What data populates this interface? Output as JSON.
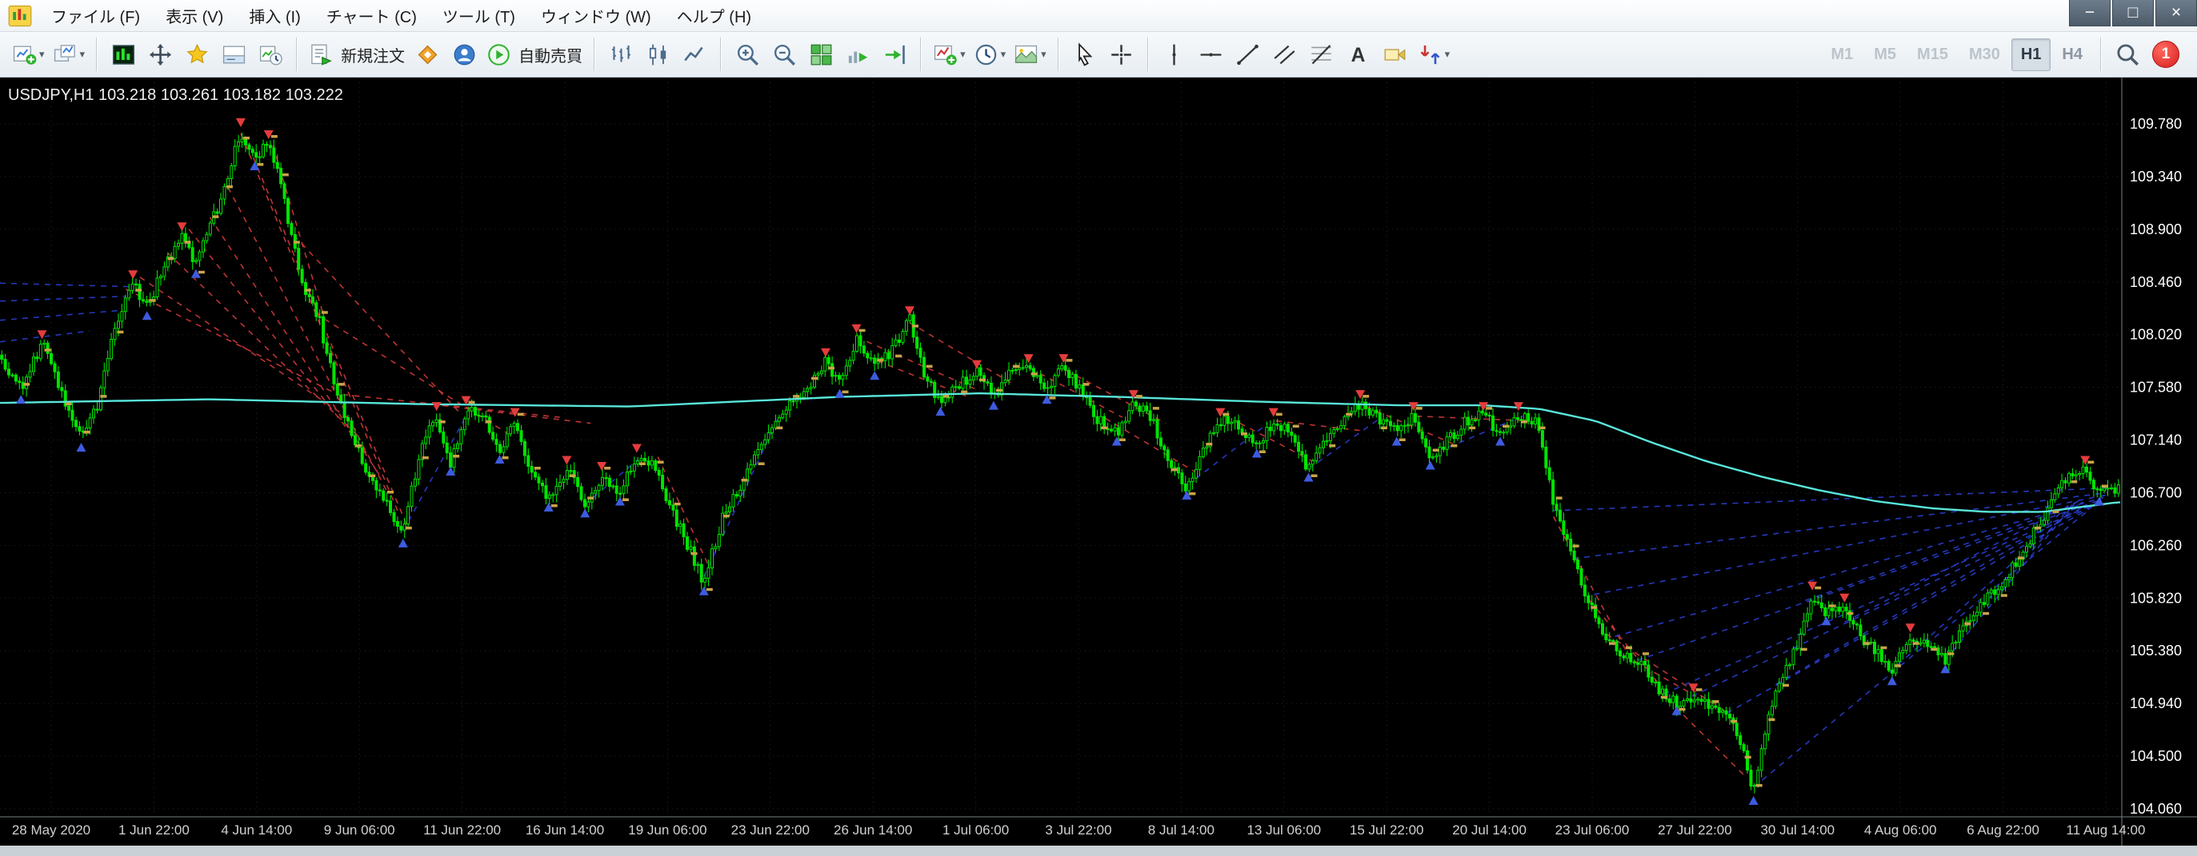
{
  "window": {
    "controls": [
      {
        "name": "minimize"
      },
      {
        "name": "maximize"
      },
      {
        "name": "close"
      }
    ]
  },
  "menu": {
    "items": [
      "ファイル (F)",
      "表示 (V)",
      "挿入 (I)",
      "チャート (C)",
      "ツール (T)",
      "ウィンドウ (W)",
      "ヘルプ (H)"
    ]
  },
  "toolbar": {
    "groups": [
      {
        "items": [
          {
            "icon": "new-chart",
            "caret": true
          },
          {
            "icon": "profiles",
            "caret": true
          }
        ]
      },
      {
        "items": [
          {
            "icon": "market-watch"
          },
          {
            "icon": "data-window"
          },
          {
            "icon": "navigator"
          },
          {
            "icon": "terminal"
          },
          {
            "icon": "strategy-tester"
          }
        ]
      },
      {
        "items": [
          {
            "icon": "new-order",
            "label": "新規注文"
          },
          {
            "icon": "metaeditor"
          },
          {
            "icon": "mql-community"
          },
          {
            "icon": "autotrading",
            "label": "自動売買"
          }
        ]
      },
      {
        "items": [
          {
            "icon": "bar-chart"
          },
          {
            "icon": "candlestick-chart"
          },
          {
            "icon": "line-chart"
          }
        ]
      },
      {
        "items": [
          {
            "icon": "zoom-in"
          },
          {
            "icon": "zoom-out"
          },
          {
            "icon": "tile-windows"
          },
          {
            "icon": "auto-scroll"
          },
          {
            "icon": "chart-shift"
          }
        ]
      },
      {
        "items": [
          {
            "icon": "indicators",
            "caret": true
          },
          {
            "icon": "periods",
            "caret": true
          },
          {
            "icon": "templates",
            "caret": true
          }
        ]
      },
      {
        "items": [
          {
            "icon": "cursor"
          },
          {
            "icon": "crosshair"
          }
        ]
      },
      {
        "items": [
          {
            "icon": "vertical-line"
          },
          {
            "icon": "horizontal-line"
          },
          {
            "icon": "trendline"
          },
          {
            "icon": "equidistant-channel"
          },
          {
            "icon": "fibonacci"
          },
          {
            "icon": "text"
          },
          {
            "icon": "text-label"
          },
          {
            "icon": "arrows",
            "caret": true
          }
        ]
      }
    ],
    "timeframes": [
      {
        "label": "M1",
        "style": "muted"
      },
      {
        "label": "M5",
        "style": "muted"
      },
      {
        "label": "M15",
        "style": "muted"
      },
      {
        "label": "M30",
        "style": "muted"
      },
      {
        "label": "H1",
        "style": "active"
      },
      {
        "label": "H4",
        "style": "mid"
      }
    ],
    "notification_badge": "1"
  },
  "chart_data": {
    "type": "candlestick",
    "symbol": "USDJPY",
    "timeframe": "H1",
    "title_line": "USDJPY,H1 103.218 103.261 103.182 103.222",
    "ohlc_display": {
      "open": 103.218,
      "high": 103.261,
      "low": 103.182,
      "close": 103.222
    },
    "grid": true,
    "price_axis_range": [
      104.06,
      109.78
    ],
    "y_tick_labels": [
      "109.780",
      "109.340",
      "108.900",
      "108.460",
      "108.020",
      "107.580",
      "107.140",
      "106.700",
      "106.260",
      "105.820",
      "105.380",
      "104.940",
      "104.500",
      "104.060"
    ],
    "x_tick_labels": [
      "28 May 2020",
      "1 Jun 22:00",
      "4 Jun 14:00",
      "9 Jun 06:00",
      "11 Jun 22:00",
      "16 Jun 14:00",
      "19 Jun 06:00",
      "23 Jun 22:00",
      "26 Jun 14:00",
      "1 Jul 06:00",
      "3 Jul 22:00",
      "8 Jul 14:00",
      "13 Jul 06:00",
      "15 Jul 22:00",
      "20 Jul 14:00",
      "23 Jul 06:00",
      "27 Jul 22:00",
      "30 Jul 14:00",
      "4 Aug 06:00",
      "6 Aug 22:00",
      "11 Aug 14:00"
    ],
    "colors": {
      "background": "#000000",
      "grid": "#202629",
      "candles": "#00e400",
      "ma_line": "#58e6da",
      "sell_trade_line": "#d23a3a",
      "buy_trade_line": "#2a3fd0",
      "sell_arrow": "#e43c3c",
      "buy_arrow": "#3d5be0",
      "trade_tick": "#c9a348",
      "price_text": "#ffffff",
      "time_text": "#d0d0d0"
    },
    "path_x_max": 1515,
    "price_path": [
      [
        0,
        107.85
      ],
      [
        15,
        107.55
      ],
      [
        30,
        107.95
      ],
      [
        45,
        107.5
      ],
      [
        58,
        107.15
      ],
      [
        70,
        107.45
      ],
      [
        82,
        108.1
      ],
      [
        95,
        108.45
      ],
      [
        105,
        108.25
      ],
      [
        118,
        108.6
      ],
      [
        130,
        108.85
      ],
      [
        140,
        108.6
      ],
      [
        150,
        108.95
      ],
      [
        160,
        109.2
      ],
      [
        172,
        109.72
      ],
      [
        182,
        109.5
      ],
      [
        192,
        109.62
      ],
      [
        200,
        109.3
      ],
      [
        208,
        108.85
      ],
      [
        216,
        108.45
      ],
      [
        228,
        108.15
      ],
      [
        240,
        107.55
      ],
      [
        252,
        107.15
      ],
      [
        262,
        106.9
      ],
      [
        275,
        106.65
      ],
      [
        288,
        106.35
      ],
      [
        300,
        107.05
      ],
      [
        312,
        107.35
      ],
      [
        322,
        106.95
      ],
      [
        333,
        107.4
      ],
      [
        345,
        107.35
      ],
      [
        357,
        107.05
      ],
      [
        368,
        107.3
      ],
      [
        380,
        106.85
      ],
      [
        392,
        106.65
      ],
      [
        405,
        106.9
      ],
      [
        418,
        106.6
      ],
      [
        430,
        106.85
      ],
      [
        443,
        106.7
      ],
      [
        455,
        107.0
      ],
      [
        468,
        106.9
      ],
      [
        480,
        106.55
      ],
      [
        492,
        106.25
      ],
      [
        503,
        105.95
      ],
      [
        515,
        106.45
      ],
      [
        528,
        106.75
      ],
      [
        540,
        107.0
      ],
      [
        553,
        107.3
      ],
      [
        565,
        107.45
      ],
      [
        578,
        107.6
      ],
      [
        590,
        107.8
      ],
      [
        600,
        107.6
      ],
      [
        612,
        108.0
      ],
      [
        625,
        107.75
      ],
      [
        638,
        107.9
      ],
      [
        650,
        108.15
      ],
      [
        660,
        107.7
      ],
      [
        672,
        107.45
      ],
      [
        685,
        107.6
      ],
      [
        698,
        107.7
      ],
      [
        710,
        107.5
      ],
      [
        722,
        107.7
      ],
      [
        735,
        107.75
      ],
      [
        748,
        107.55
      ],
      [
        760,
        107.75
      ],
      [
        772,
        107.55
      ],
      [
        785,
        107.3
      ],
      [
        798,
        107.2
      ],
      [
        810,
        107.45
      ],
      [
        822,
        107.35
      ],
      [
        835,
        106.95
      ],
      [
        848,
        106.75
      ],
      [
        860,
        107.05
      ],
      [
        872,
        107.3
      ],
      [
        885,
        107.25
      ],
      [
        898,
        107.1
      ],
      [
        910,
        107.3
      ],
      [
        922,
        107.2
      ],
      [
        935,
        106.9
      ],
      [
        948,
        107.15
      ],
      [
        960,
        107.3
      ],
      [
        972,
        107.45
      ],
      [
        985,
        107.3
      ],
      [
        998,
        107.2
      ],
      [
        1010,
        107.35
      ],
      [
        1022,
        107.0
      ],
      [
        1035,
        107.15
      ],
      [
        1048,
        107.3
      ],
      [
        1060,
        107.35
      ],
      [
        1072,
        107.2
      ],
      [
        1085,
        107.35
      ],
      [
        1098,
        107.3
      ],
      [
        1110,
        106.6
      ],
      [
        1122,
        106.2
      ],
      [
        1135,
        105.8
      ],
      [
        1148,
        105.5
      ],
      [
        1160,
        105.35
      ],
      [
        1172,
        105.3
      ],
      [
        1185,
        105.05
      ],
      [
        1198,
        104.95
      ],
      [
        1210,
        105.0
      ],
      [
        1222,
        104.9
      ],
      [
        1235,
        104.85
      ],
      [
        1245,
        104.55
      ],
      [
        1253,
        104.2
      ],
      [
        1262,
        104.75
      ],
      [
        1272,
        105.15
      ],
      [
        1285,
        105.45
      ],
      [
        1295,
        105.85
      ],
      [
        1305,
        105.7
      ],
      [
        1318,
        105.75
      ],
      [
        1330,
        105.5
      ],
      [
        1342,
        105.35
      ],
      [
        1352,
        105.2
      ],
      [
        1365,
        105.5
      ],
      [
        1378,
        105.45
      ],
      [
        1390,
        105.3
      ],
      [
        1402,
        105.55
      ],
      [
        1415,
        105.75
      ],
      [
        1428,
        105.9
      ],
      [
        1440,
        106.1
      ],
      [
        1452,
        106.35
      ],
      [
        1465,
        106.6
      ],
      [
        1478,
        106.85
      ],
      [
        1490,
        106.9
      ],
      [
        1500,
        106.7
      ],
      [
        1513,
        106.75
      ]
    ],
    "ma_path": [
      [
        0,
        107.45
      ],
      [
        150,
        107.48
      ],
      [
        300,
        107.44
      ],
      [
        450,
        107.42
      ],
      [
        600,
        107.5
      ],
      [
        700,
        107.53
      ],
      [
        800,
        107.5
      ],
      [
        900,
        107.46
      ],
      [
        1000,
        107.43
      ],
      [
        1060,
        107.43
      ],
      [
        1100,
        107.4
      ],
      [
        1140,
        107.3
      ],
      [
        1180,
        107.12
      ],
      [
        1220,
        106.96
      ],
      [
        1260,
        106.83
      ],
      [
        1300,
        106.72
      ],
      [
        1340,
        106.63
      ],
      [
        1380,
        106.57
      ],
      [
        1420,
        106.54
      ],
      [
        1460,
        106.54
      ],
      [
        1500,
        106.6
      ],
      [
        1513,
        106.62
      ]
    ],
    "trade_lines": {
      "sell": [
        [
          90,
          108.4,
          245,
          107.5
        ],
        [
          100,
          108.5,
          252,
          107.3
        ],
        [
          120,
          108.7,
          258,
          107.15
        ],
        [
          135,
          108.9,
          264,
          107.0
        ],
        [
          150,
          109.0,
          271,
          106.85
        ],
        [
          163,
          109.25,
          277,
          106.7
        ],
        [
          172,
          109.7,
          284,
          106.55
        ],
        [
          181,
          109.5,
          291,
          106.42
        ],
        [
          195,
          109.6,
          232,
          108.15
        ],
        [
          210,
          108.85,
          330,
          107.35
        ],
        [
          225,
          108.2,
          362,
          107.2
        ],
        [
          245,
          107.52,
          400,
          107.33
        ],
        [
          300,
          107.45,
          422,
          107.28
        ],
        [
          470,
          107.0,
          506,
          106.1
        ],
        [
          612,
          108.0,
          700,
          107.55
        ],
        [
          650,
          108.12,
          722,
          107.62
        ],
        [
          627,
          107.8,
          692,
          107.5
        ],
        [
          736,
          107.74,
          802,
          107.33
        ],
        [
          762,
          107.72,
          833,
          107.28
        ],
        [
          790,
          107.32,
          856,
          106.86
        ],
        [
          886,
          107.28,
          940,
          106.95
        ],
        [
          912,
          107.3,
          972,
          107.22
        ],
        [
          976,
          107.42,
          1040,
          107.1
        ],
        [
          1012,
          107.34,
          1092,
          107.3
        ],
        [
          1110,
          106.5,
          1162,
          105.38
        ],
        [
          1136,
          105.8,
          1187,
          105.08
        ],
        [
          1161,
          105.34,
          1212,
          105.0
        ],
        [
          1186,
          105.04,
          1248,
          104.32
        ],
        [
          1148,
          105.52,
          1232,
          104.88
        ]
      ],
      "buy": [
        [
          0,
          108.45,
          96,
          108.42
        ],
        [
          0,
          108.3,
          90,
          108.34
        ],
        [
          0,
          108.14,
          84,
          108.22
        ],
        [
          0,
          107.96,
          64,
          108.05
        ],
        [
          288,
          106.38,
          334,
          107.36
        ],
        [
          418,
          106.6,
          456,
          106.98
        ],
        [
          503,
          106.0,
          556,
          107.32
        ],
        [
          848,
          106.76,
          906,
          107.28
        ],
        [
          935,
          106.9,
          986,
          107.32
        ],
        [
          1035,
          107.08,
          1088,
          107.34
        ],
        [
          1110,
          106.55,
          1507,
          106.74
        ],
        [
          1124,
          106.15,
          1506,
          106.7
        ],
        [
          1139,
          105.85,
          1505,
          106.68
        ],
        [
          1154,
          105.5,
          1503,
          106.66
        ],
        [
          1170,
          105.3,
          1501,
          106.64
        ],
        [
          1189,
          105.02,
          1499,
          106.62
        ],
        [
          1209,
          105.0,
          1497,
          106.6
        ],
        [
          1234,
          104.86,
          1495,
          106.58
        ],
        [
          1253,
          104.24,
          1493,
          106.56
        ],
        [
          1269,
          105.1,
          1491,
          106.6
        ],
        [
          1290,
          105.8,
          1489,
          106.62
        ],
        [
          1318,
          105.62,
          1487,
          106.64
        ],
        [
          1350,
          105.2,
          1485,
          106.6
        ],
        [
          1390,
          105.3,
          1483,
          106.62
        ],
        [
          1420,
          105.8,
          1481,
          106.6
        ],
        [
          1452,
          106.3,
          1480,
          106.62
        ]
      ]
    }
  }
}
